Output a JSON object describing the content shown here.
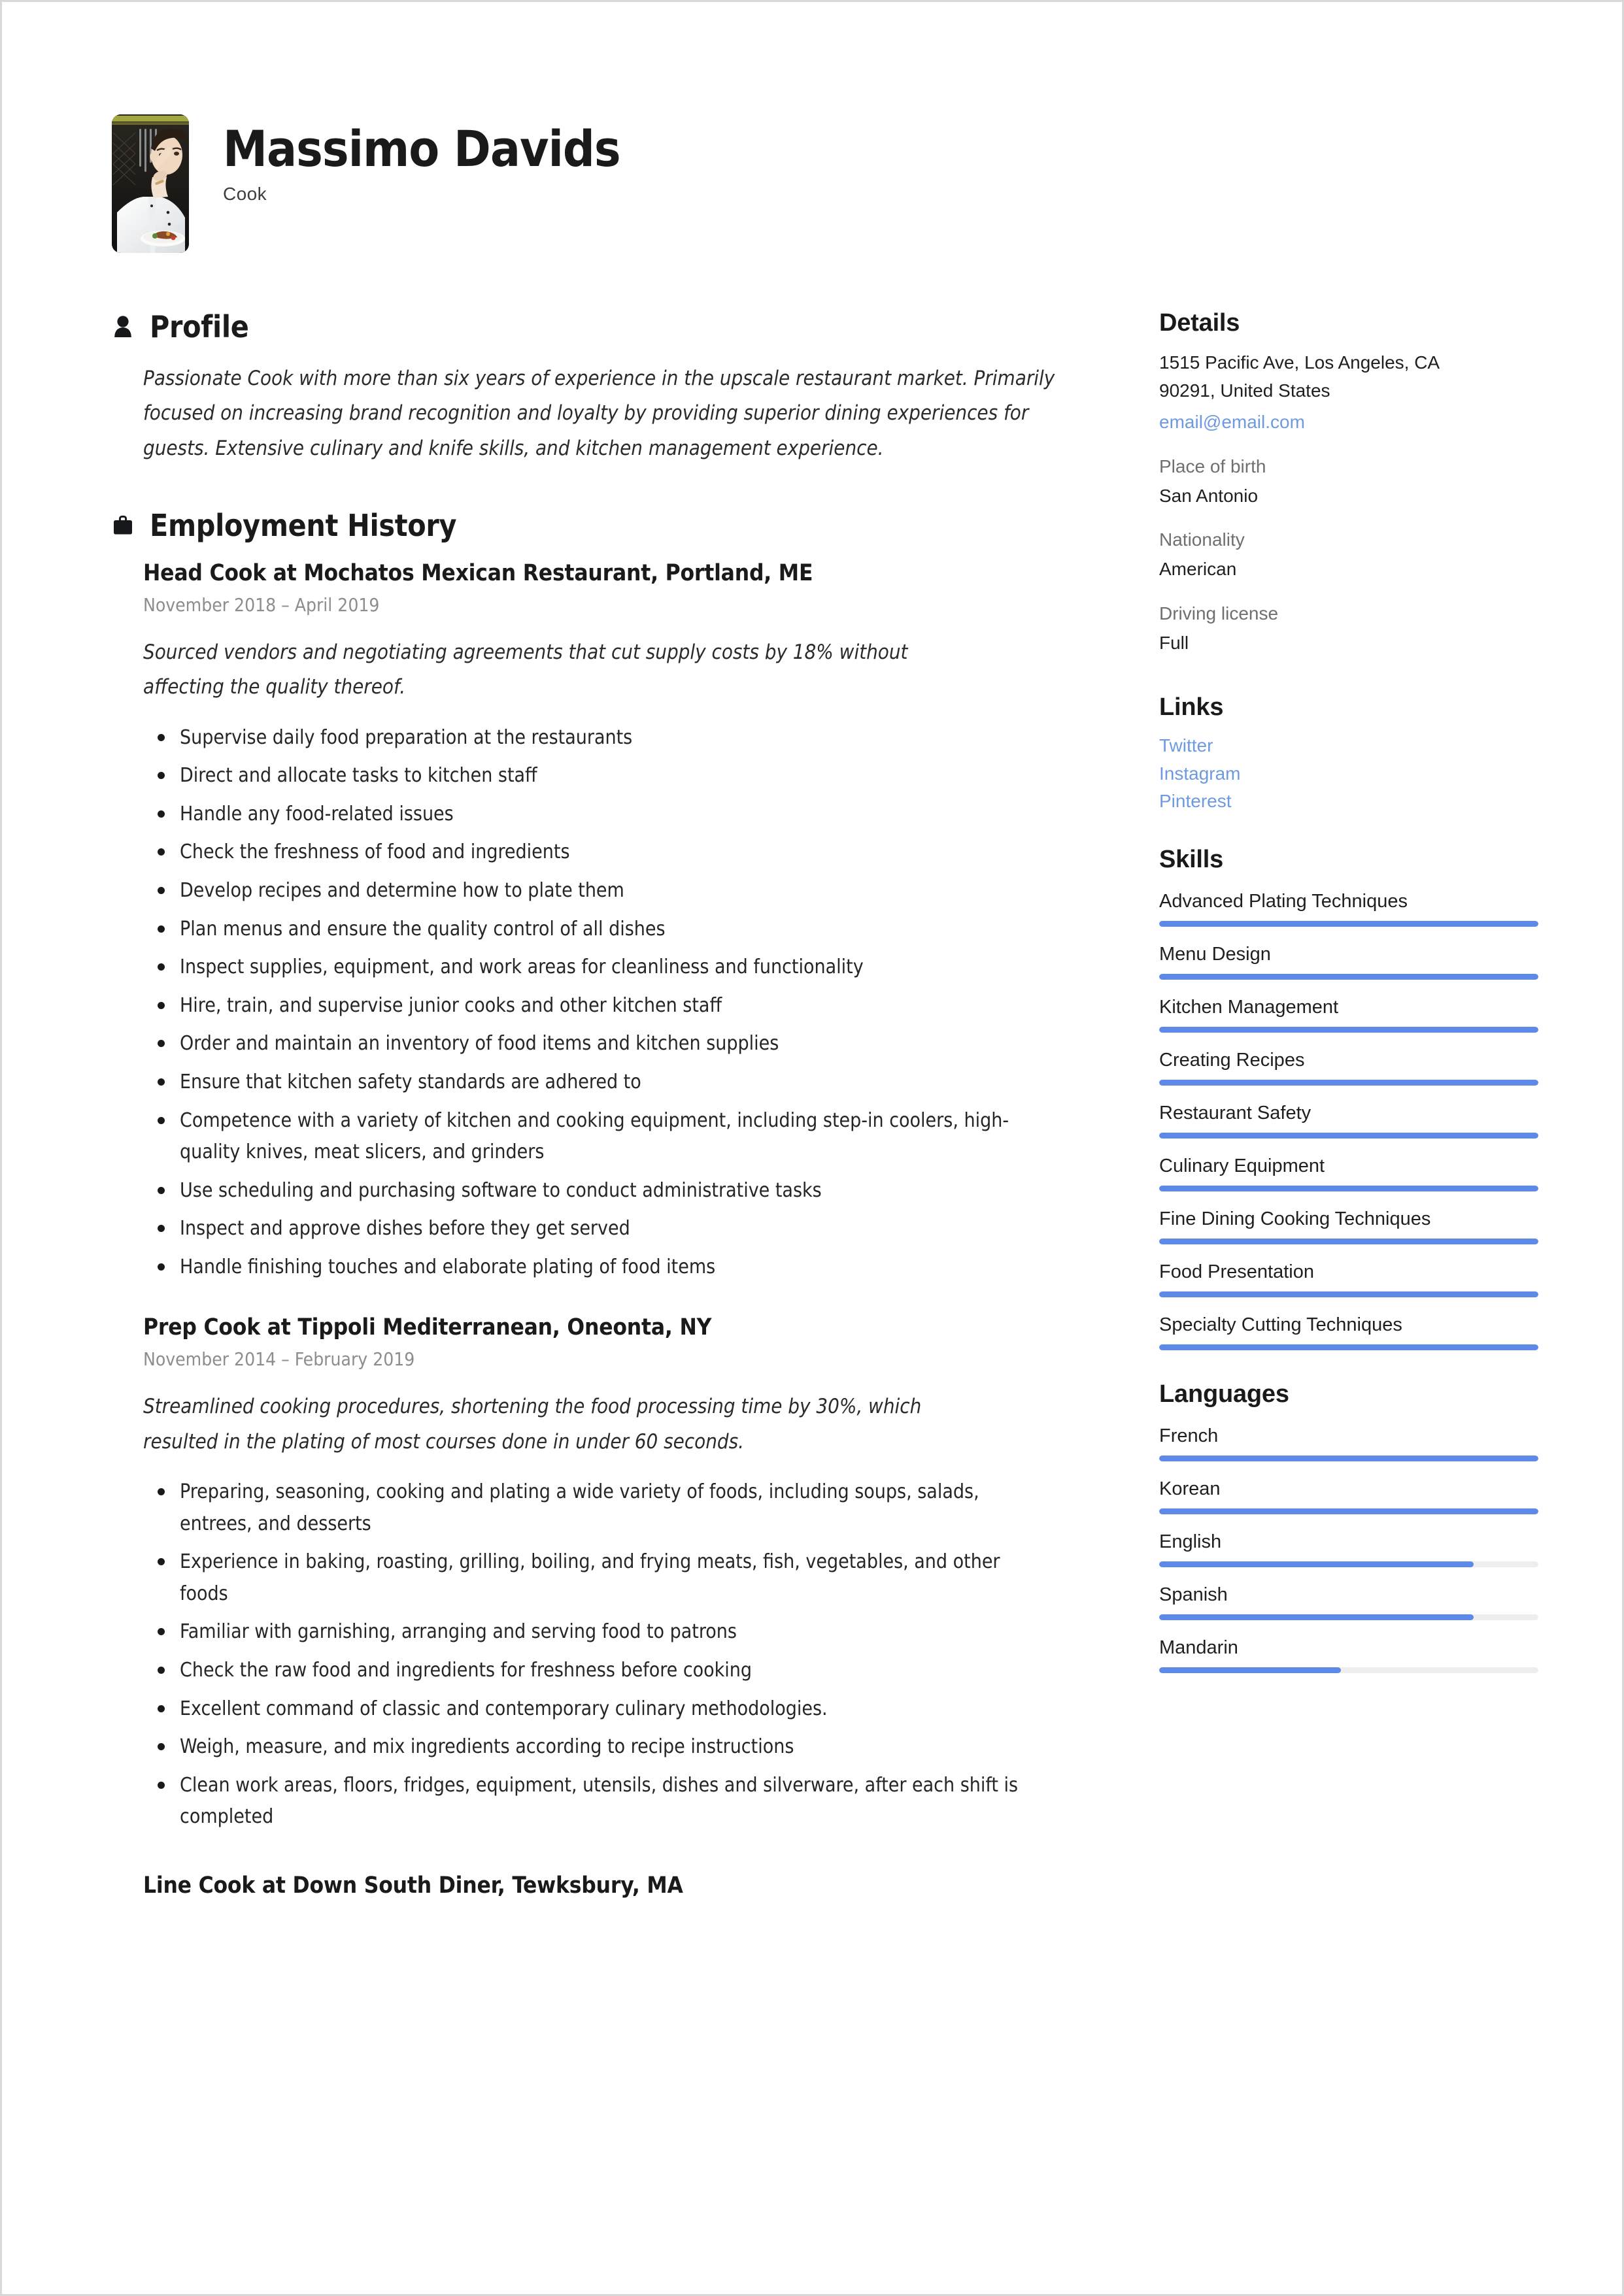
{
  "header": {
    "name": "Massimo Davids",
    "job_title": "Cook",
    "photo_alt": "chef-portrait"
  },
  "profile": {
    "section_title": "Profile",
    "icon": "person-icon",
    "text": "Passionate Cook with more than six years of experience in the upscale restaurant market. Primarily focused on increasing brand recognition and loyalty by providing superior dining experiences for guests. Extensive culinary and knife skills, and kitchen management experience."
  },
  "employment": {
    "section_title": "Employment History",
    "icon": "briefcase-icon",
    "jobs": [
      {
        "title": "Head Cook at Mochatos Mexican Restaurant, Portland, ME",
        "dates": "November 2018  –  April 2019",
        "description": "Sourced vendors and negotiating agreements that cut supply costs by 18% without affecting the quality thereof.",
        "bullets": [
          "Supervise daily food preparation at the restaurants",
          "Direct and allocate tasks to kitchen staff",
          "Handle any food-related issues",
          "Check the freshness of food and ingredients",
          "Develop recipes and determine how to plate them",
          "Plan menus and ensure the quality control of all dishes",
          "Inspect supplies, equipment, and work areas for cleanliness and functionality",
          "Hire, train, and supervise junior cooks and other kitchen staff",
          "Order and maintain an inventory of food items and kitchen supplies",
          "Ensure that kitchen safety standards are adhered to",
          "Competence with a variety of kitchen and cooking equipment, including step-in coolers, high-quality knives, meat slicers, and grinders",
          "Use scheduling and purchasing software to conduct administrative tasks",
          "Inspect and approve dishes before they get served",
          "Handle finishing touches and elaborate plating of food items"
        ]
      },
      {
        "title": "Prep Cook at Tippoli Mediterranean, Oneonta, NY",
        "dates": "November 2014  –  February 2019",
        "description": "Streamlined cooking procedures, shortening the food processing time by 30%, which resulted in the plating of most courses done in under 60 seconds.",
        "bullets": [
          "Preparing, seasoning, cooking and plating a wide variety of foods, including soups, salads, entrees, and desserts",
          "Experience in baking, roasting, grilling, boiling, and frying meats, fish, vegetables, and other foods",
          "Familiar with garnishing, arranging and serving food to patrons",
          "Check the raw food and ingredients for freshness before cooking",
          "Excellent command of classic and contemporary culinary methodologies.",
          "Weigh, measure, and mix ingredients according to recipe instructions",
          "Clean work areas, floors, fridges, equipment, utensils, dishes and silverware, after each shift is completed"
        ]
      },
      {
        "title": "Line Cook at Down South Diner, Tewksbury, MA",
        "dates": "",
        "description": "",
        "bullets": []
      }
    ]
  },
  "details": {
    "section_title": "Details",
    "address_line1": "1515 Pacific Ave, Los Angeles, CA",
    "address_line2": "90291, United States",
    "email": "email@email.com",
    "fields": [
      {
        "label": "Place of birth",
        "value": "San Antonio"
      },
      {
        "label": "Nationality",
        "value": "American"
      },
      {
        "label": "Driving license",
        "value": "Full"
      }
    ]
  },
  "links": {
    "section_title": "Links",
    "items": [
      "Twitter",
      "Instagram",
      "Pinterest"
    ]
  },
  "skills": {
    "section_title": "Skills",
    "items": [
      {
        "label": "Advanced Plating Techniques",
        "level": 100
      },
      {
        "label": "Menu Design",
        "level": 100
      },
      {
        "label": "Kitchen Management",
        "level": 100
      },
      {
        "label": "Creating Recipes",
        "level": 100
      },
      {
        "label": "Restaurant Safety",
        "level": 100
      },
      {
        "label": "Culinary Equipment",
        "level": 100
      },
      {
        "label": "Fine Dining Cooking Techniques",
        "level": 100
      },
      {
        "label": "Food Presentation",
        "level": 100
      },
      {
        "label": "Specialty Cutting Techniques",
        "level": 100
      }
    ]
  },
  "languages": {
    "section_title": "Languages",
    "items": [
      {
        "label": "French",
        "level": 100
      },
      {
        "label": "Korean",
        "level": 100
      },
      {
        "label": "English",
        "level": 83
      },
      {
        "label": "Spanish",
        "level": 83
      },
      {
        "label": "Mandarin",
        "level": 48
      }
    ]
  },
  "colors": {
    "accent_blue": "#5c8ae6",
    "link_blue": "#6d9ae0",
    "bar_track": "#f0eeec",
    "text": "#1a1a1a",
    "muted": "#8d8d8d"
  }
}
